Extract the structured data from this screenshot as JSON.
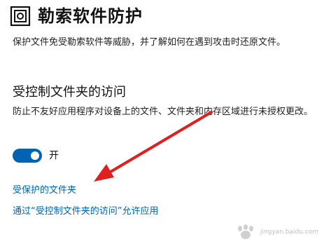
{
  "header": {
    "title": "勒索软件防护",
    "icon": "ransomware-protection-icon"
  },
  "subtitle": "保护文件免受勒索软件等威胁，并了解如何在遇到攻击时还原文件。",
  "controlled_folder_access": {
    "title": "受控制文件夹的访问",
    "description": "防止不友好应用程序对设备上的文件、文件夹和内存区域进行未授权更改。",
    "toggle": {
      "state": "on",
      "label": "开",
      "color": "#0063b1"
    },
    "links": {
      "protected_folders": "受保护的文件夹",
      "allow_app": "通过“受控制文件夹的访问”允许应用"
    }
  },
  "annotation": {
    "arrow_color": "#e02020"
  },
  "watermark": {
    "text": "jingyan.baidu.com"
  }
}
